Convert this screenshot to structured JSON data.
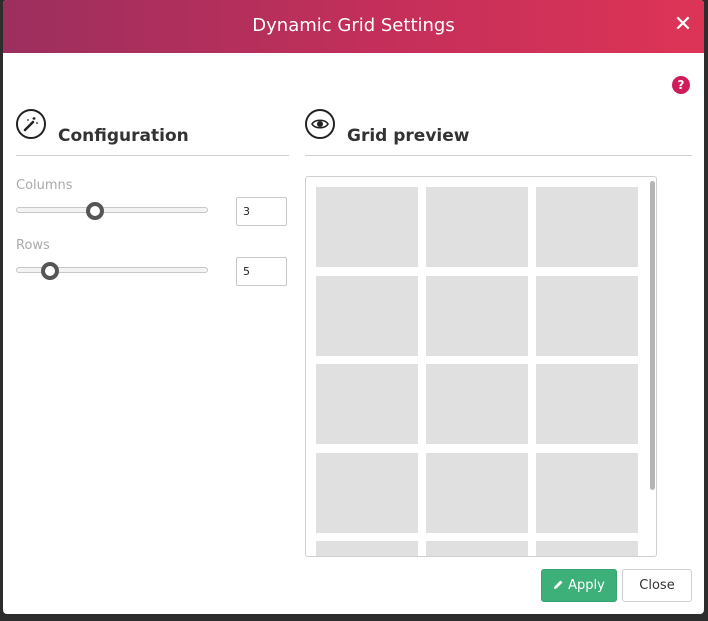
{
  "dialog": {
    "title": "Dynamic Grid Settings",
    "close_icon": "close-icon",
    "help_icon": "help-icon",
    "help_symbol": "?"
  },
  "configuration": {
    "title": "Configuration",
    "icon": "magic-wand-icon",
    "columns": {
      "label": "Columns",
      "value": "3"
    },
    "rows": {
      "label": "Rows",
      "value": "5"
    }
  },
  "preview": {
    "title": "Grid preview",
    "icon": "eye-icon",
    "columns": 3,
    "rows": 5
  },
  "footer": {
    "apply_label": "Apply",
    "apply_icon": "pencil-icon",
    "close_label": "Close"
  },
  "colors": {
    "title_gradient_start": "#9c2f5e",
    "title_gradient_end": "#dd3456",
    "apply_green": "#3daf79",
    "help_pink": "#cf1d5b",
    "cell_gray": "#e0e0e0"
  }
}
